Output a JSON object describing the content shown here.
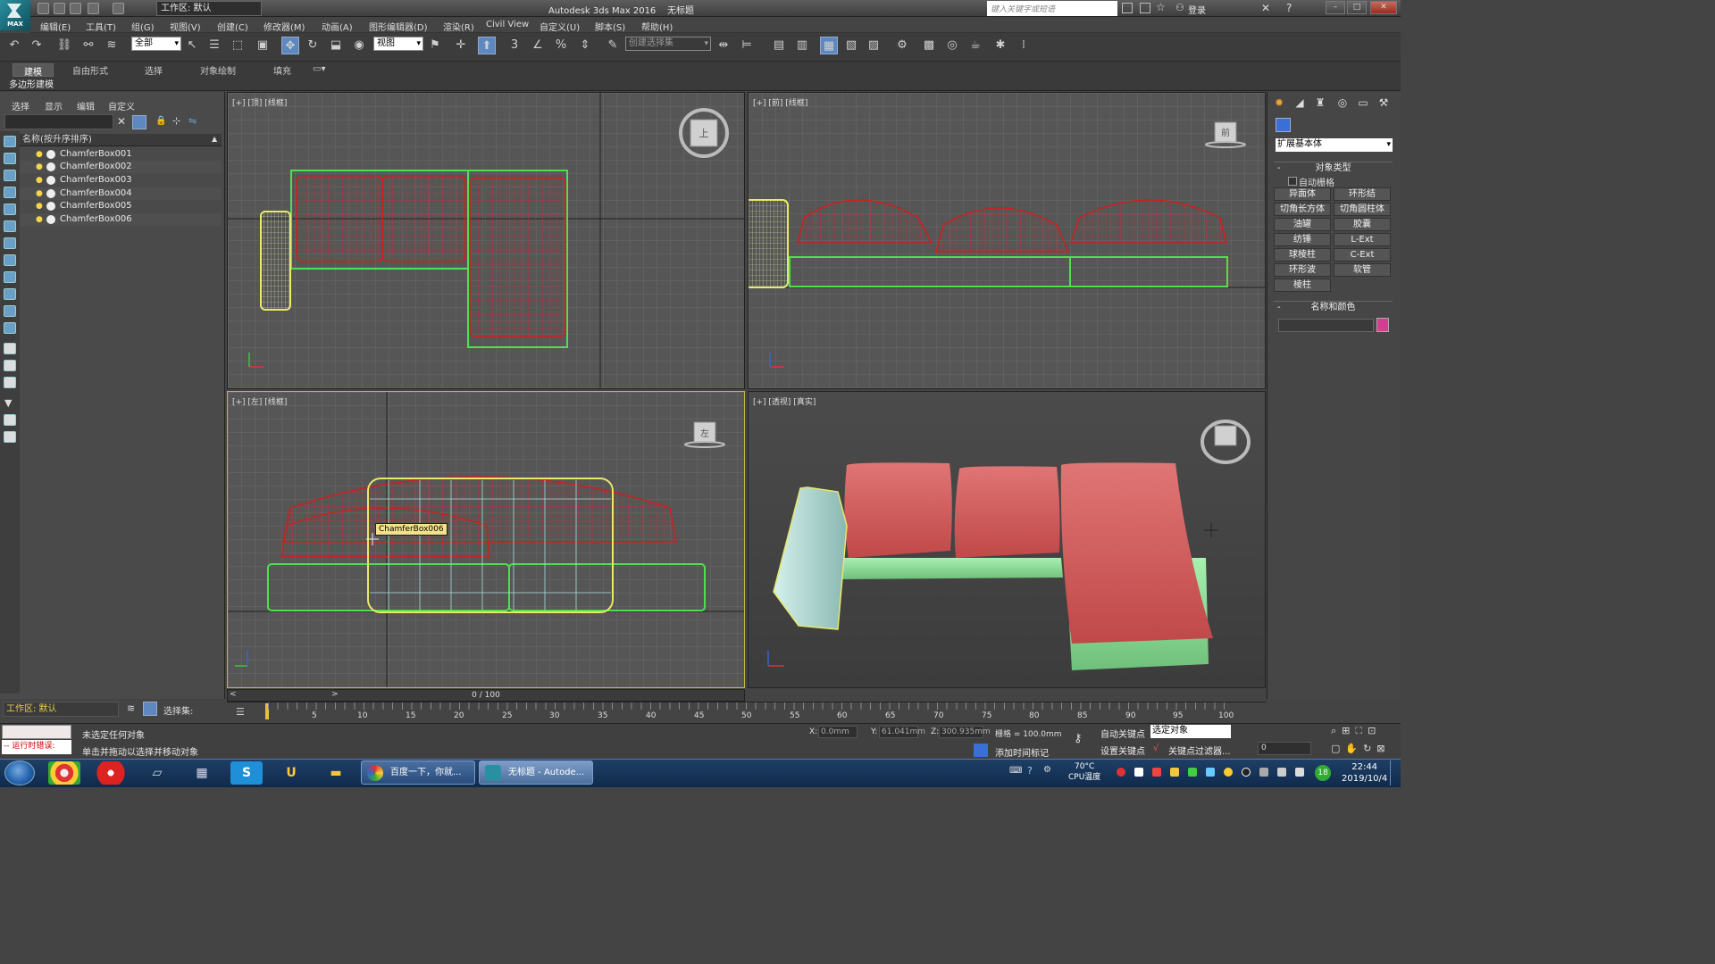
{
  "titlebar": {
    "workspace": "工作区: 默认",
    "app_title": "Autodesk 3ds Max 2016",
    "doc_title": "无标题",
    "search_placeholder": "键入关键字或短语",
    "login": "登录",
    "logo_text": "MAX"
  },
  "menu": [
    "编辑(E)",
    "工具(T)",
    "组(G)",
    "视图(V)",
    "创建(C)",
    "修改器(M)",
    "动画(A)",
    "图形编辑器(D)",
    "渲染(R)",
    "Civil View",
    "自定义(U)",
    "脚本(S)",
    "帮助(H)"
  ],
  "toolbar": {
    "filter": "全部",
    "refcoord": "视图",
    "selset": "创建选择集",
    "snap_labels": [
      "3",
      "%"
    ]
  },
  "ribbon": {
    "tabs": [
      "建模",
      "自由形式",
      "选择",
      "对象绘制",
      "填充"
    ],
    "sub": "多边形建模"
  },
  "explorer": {
    "menu": [
      "选择",
      "显示",
      "编辑",
      "自定义"
    ],
    "column_header": "名称(按升序排序)",
    "objects": [
      "ChamferBox001",
      "ChamferBox002",
      "ChamferBox003",
      "ChamferBox004",
      "ChamferBox005",
      "ChamferBox006"
    ],
    "workspace": "工作区: 默认",
    "selset_label": "选择集:"
  },
  "viewports": {
    "top": "[+] [顶] [线框]",
    "front": "[+] [前] [线框]",
    "left": "[+] [左] [线框]",
    "persp": "[+] [透视] [真实]",
    "cube_top": "上",
    "cube_front": "前",
    "cube_left": "左",
    "tooltip": "ChamferBox006"
  },
  "command_panel": {
    "category": "扩展基本体",
    "object_type_title": "对象类型",
    "autogrid": "自动栅格",
    "primitives": [
      "异面体",
      "环形结",
      "切角长方体",
      "切角圆柱体",
      "油罐",
      "胶囊",
      "纺锤",
      "L-Ext",
      "球棱柱",
      "C-Ext",
      "环形波",
      "软管",
      "棱柱"
    ],
    "name_color_title": "名称和颜色",
    "colors": {
      "swatch": "#3a6fd8",
      "object": "#d33e8e"
    }
  },
  "timeline": {
    "slider": "0 / 100",
    "ticks": [
      "5",
      "10",
      "15",
      "20",
      "25",
      "30",
      "35",
      "40",
      "45",
      "50",
      "55",
      "60",
      "65",
      "70",
      "75",
      "80",
      "85",
      "90",
      "95",
      "100"
    ]
  },
  "status": {
    "runtime_error": "-- 运行时错误:",
    "line1": "未选定任何对象",
    "line2": "单击并拖动以选择并移动对象",
    "x_label": "X:",
    "x_value": "0.0mm",
    "y_label": "Y:",
    "y_value": "61.041mm",
    "z_label": "Z:",
    "z_value": "300.935mm",
    "grid": "栅格 = 100.0mm",
    "add_time_tag": "添加时间标记",
    "auto_key": "自动关键点",
    "set_key": "设置关键点",
    "selected_object": "选定对象",
    "key_filter": "关键点过滤器...",
    "frame": "0"
  },
  "taskbar": {
    "task1": "百度一下，你就...",
    "task2": "无标题 - Autode...",
    "temp": "70°C",
    "temp_label": "CPU温度",
    "time": "22:44",
    "date": "2019/10/4",
    "badge": "18"
  }
}
